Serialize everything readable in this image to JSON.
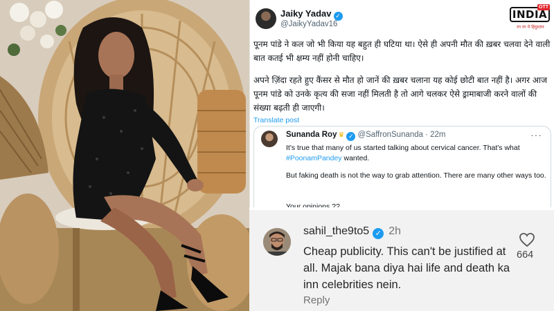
{
  "tweet": {
    "author_name": "Jaiky Yadav",
    "author_handle": "@JaikyYadav16",
    "paragraph_1": "पूनम पांडे ने कल जो भी किया यह बहुत ही घटिया था। ऐसे ही अपनी मौत की ख़बर चलवा देने वाली बात कतई भी क्षम्य नहीं होनी चाहिए।",
    "paragraph_2": "अपने ज़िंदा रहते हुए कैंसर से मौत हो जानें की ख़बर चलाना यह कोई छोटी बात नहीं है। अगर आज पूनम पांडे को उनके कृत्य की सजा नहीं मिलती है तो आगे चलकर ऐसे ड्रामाबाजी करने वालों की संख्या बढ़ती ही जाएगी।",
    "translate_label": "Translate post"
  },
  "quoted_tweet": {
    "author_name": "Sunanda Roy",
    "author_handle": "@SaffronSunanda",
    "time": "· 22m",
    "more": "···",
    "line_1_before": "It's true that many of us started talking about cervical cancer. That's what ",
    "hashtag": "#PoonamPandey",
    "line_1_after": " wanted.",
    "line_2": "But faking death is not the way to grab attention. There are many other ways too.",
    "line_3": "Your opinions ??"
  },
  "reply": {
    "username": "sahil_the9to5",
    "time": "2h",
    "text": "Cheap publicity. This can't be justified at all. Majak bana diya hai life and death ka inn celebrities nein.",
    "reply_label": "Reply",
    "like_count": "664"
  },
  "watermark": {
    "brand": "INDIA",
    "badge": "OTT",
    "tagline": "रग रग में हिंदुस्तान"
  },
  "icons": {
    "verified": "verified-badge-icon",
    "heart": "heart-icon",
    "more": "more-options-icon"
  },
  "colors": {
    "link_blue": "#1d9bf0",
    "verified_blue": "#1d9bf0",
    "logo_red": "#e0262b"
  }
}
